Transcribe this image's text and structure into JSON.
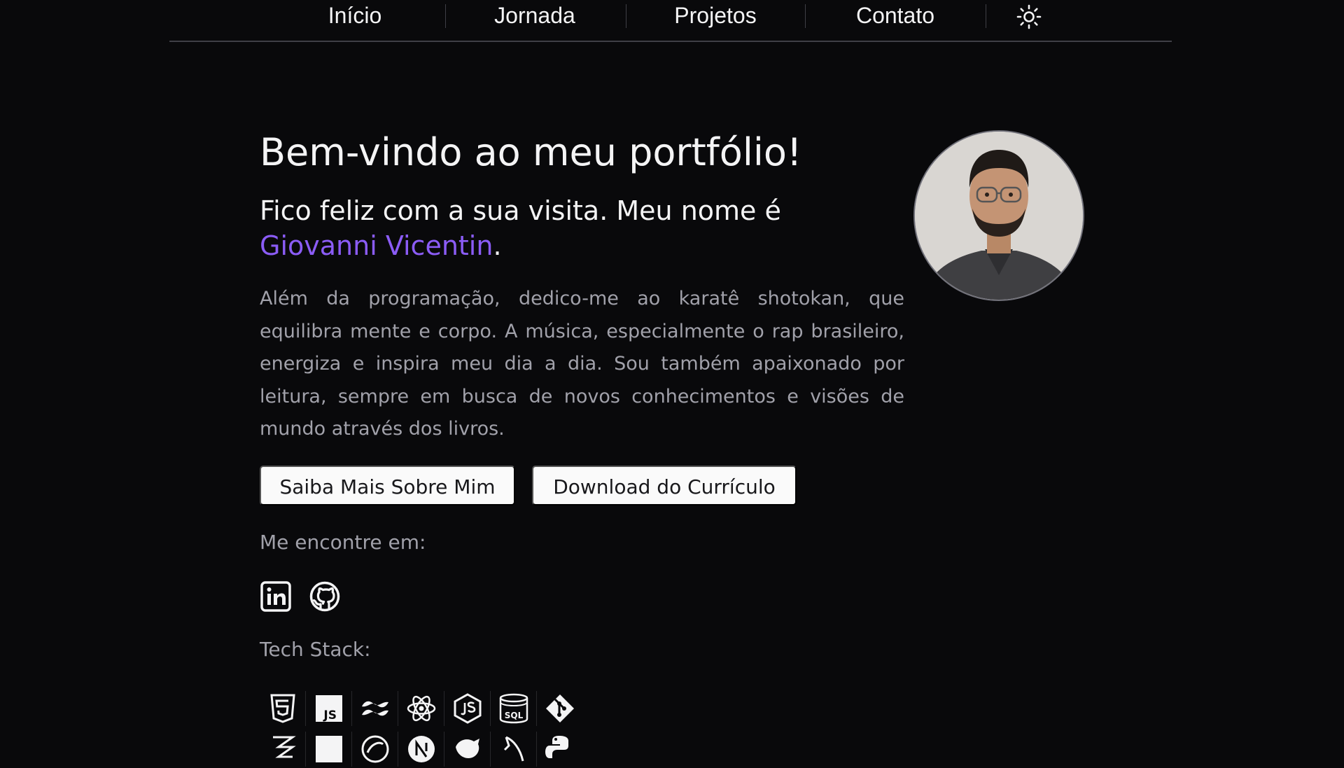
{
  "nav": {
    "items": [
      "Início",
      "Jornada",
      "Projetos",
      "Contato"
    ],
    "theme_icon": "sun-icon"
  },
  "hero": {
    "title": "Bem-vindo ao meu portfólio!",
    "subtitle_prefix": "Fico feliz com a sua visita. Meu nome é",
    "name": "Giovanni Vicentin",
    "subtitle_suffix": ".",
    "name_color": "#8b5cf6",
    "bio": "Além da programação, dedico-me ao karatê shotokan, que equilibra mente e corpo. A música, especialmente o rap brasileiro, energiza e inspira meu dia a dia. Sou também apaixonado por leitura, sempre em busca de novos conhecimentos e visões de mundo através dos livros."
  },
  "buttons": {
    "about": "Saiba Mais Sobre Mim",
    "cv": "Download do Currículo"
  },
  "social": {
    "label": "Me encontre em:",
    "icons": [
      "linkedin-icon",
      "github-icon"
    ]
  },
  "stack": {
    "label": "Tech Stack:",
    "row1": [
      "html5-icon",
      "javascript-icon",
      "tailwind-icon",
      "react-icon",
      "nodejs-icon",
      "sql-icon",
      "git-icon"
    ],
    "row2_partial": [
      "zustand-icon",
      "typescript-icon",
      "prisma-icon",
      "nextjs-icon",
      "nestjs-icon",
      "fastify-icon",
      "python-icon"
    ]
  },
  "colors": {
    "background": "#09090b",
    "text": "#f4f4f5",
    "muted": "#a1a1aa",
    "accent": "#8b5cf6",
    "button_bg": "#fafafa"
  }
}
